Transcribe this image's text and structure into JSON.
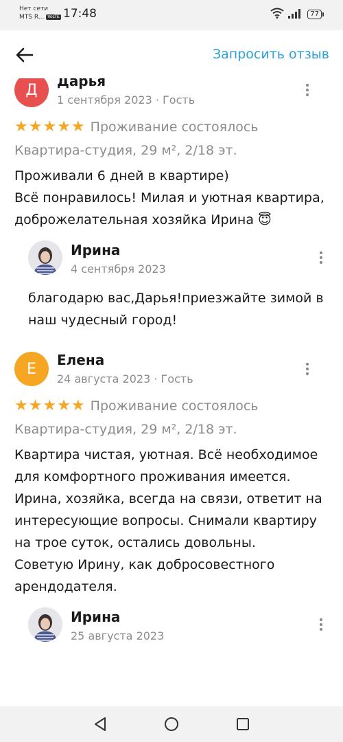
{
  "status_bar": {
    "carrier_line1": "Нет сети",
    "carrier_line2": "MTS R...",
    "volte": "VoLTE",
    "time": "17:48",
    "battery": "77",
    "icons": [
      "wifi-icon",
      "signal-icon",
      "battery-icon"
    ]
  },
  "appbar": {
    "back_icon": "arrow-left-icon",
    "request_review_label": "Запросить отзыв",
    "accent_color": "#2a9fd8"
  },
  "reviews": [
    {
      "avatar_letter": "Д",
      "avatar_color": "#e84f4f",
      "name": "Дарья",
      "meta": "1 сентября 2023 · Гость",
      "rating": 5,
      "stay_status": "Проживание состоялось",
      "object": "Квартира-студия, 29 м², 2/18 эт.",
      "text": "Проживали 6 дней в квартире)\nВсё понравилось! Милая и уютная квартира, доброжелательная хозяйка Ирина 😇",
      "reply": {
        "name": "Ирина",
        "date": "4 сентября 2023",
        "text": "благодарю вас,Дарья!приезжайте зимой в наш чудесный город!"
      }
    },
    {
      "avatar_letter": "Е",
      "avatar_color": "#f5a623",
      "name": "Елена",
      "meta": "24 августа 2023 · Гость",
      "rating": 5,
      "stay_status": "Проживание состоялось",
      "object": "Квартира-студия, 29 м², 2/18 эт.",
      "text": "Квартира чистая, уютная. Всё необходимое для комфортного проживания имеется. Ирина, хозяйка, всегда на связи, ответит на интересующие вопросы.  Снимали квартиру на трое суток, остались довольны.\nСоветую Ирину, как добросовестного арендодателя.",
      "reply": {
        "name": "Ирина",
        "date": "25 августа 2023",
        "text": ""
      }
    }
  ],
  "nav": {
    "back_icon": "triangle-back-icon",
    "home_icon": "circle-home-icon",
    "recents_icon": "square-recents-icon"
  }
}
